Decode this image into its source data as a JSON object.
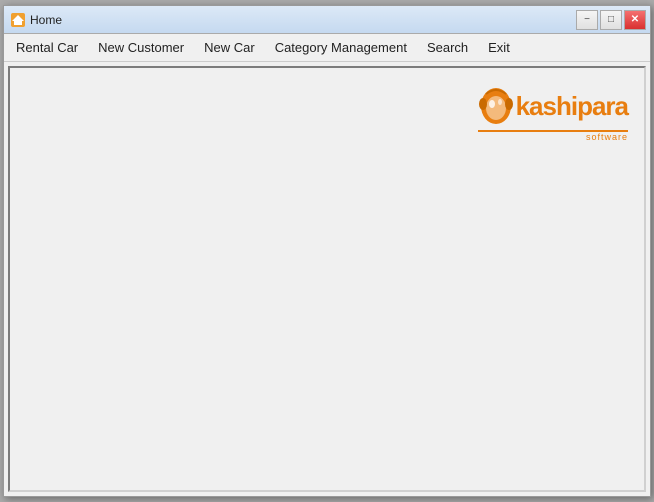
{
  "window": {
    "title": "Home",
    "icon": "home-icon"
  },
  "titlebar": {
    "title": "Home",
    "minimize_label": "−",
    "maximize_label": "□",
    "close_label": "✕"
  },
  "menubar": {
    "items": [
      {
        "id": "rental-car",
        "label": "Rental Car"
      },
      {
        "id": "new-customer",
        "label": "New Customer"
      },
      {
        "id": "new-car",
        "label": "New Car"
      },
      {
        "id": "category-management",
        "label": "Category Management"
      },
      {
        "id": "search",
        "label": "Search"
      },
      {
        "id": "exit",
        "label": "Exit"
      }
    ]
  },
  "logo": {
    "text": "kashipara",
    "tagline": "software"
  }
}
